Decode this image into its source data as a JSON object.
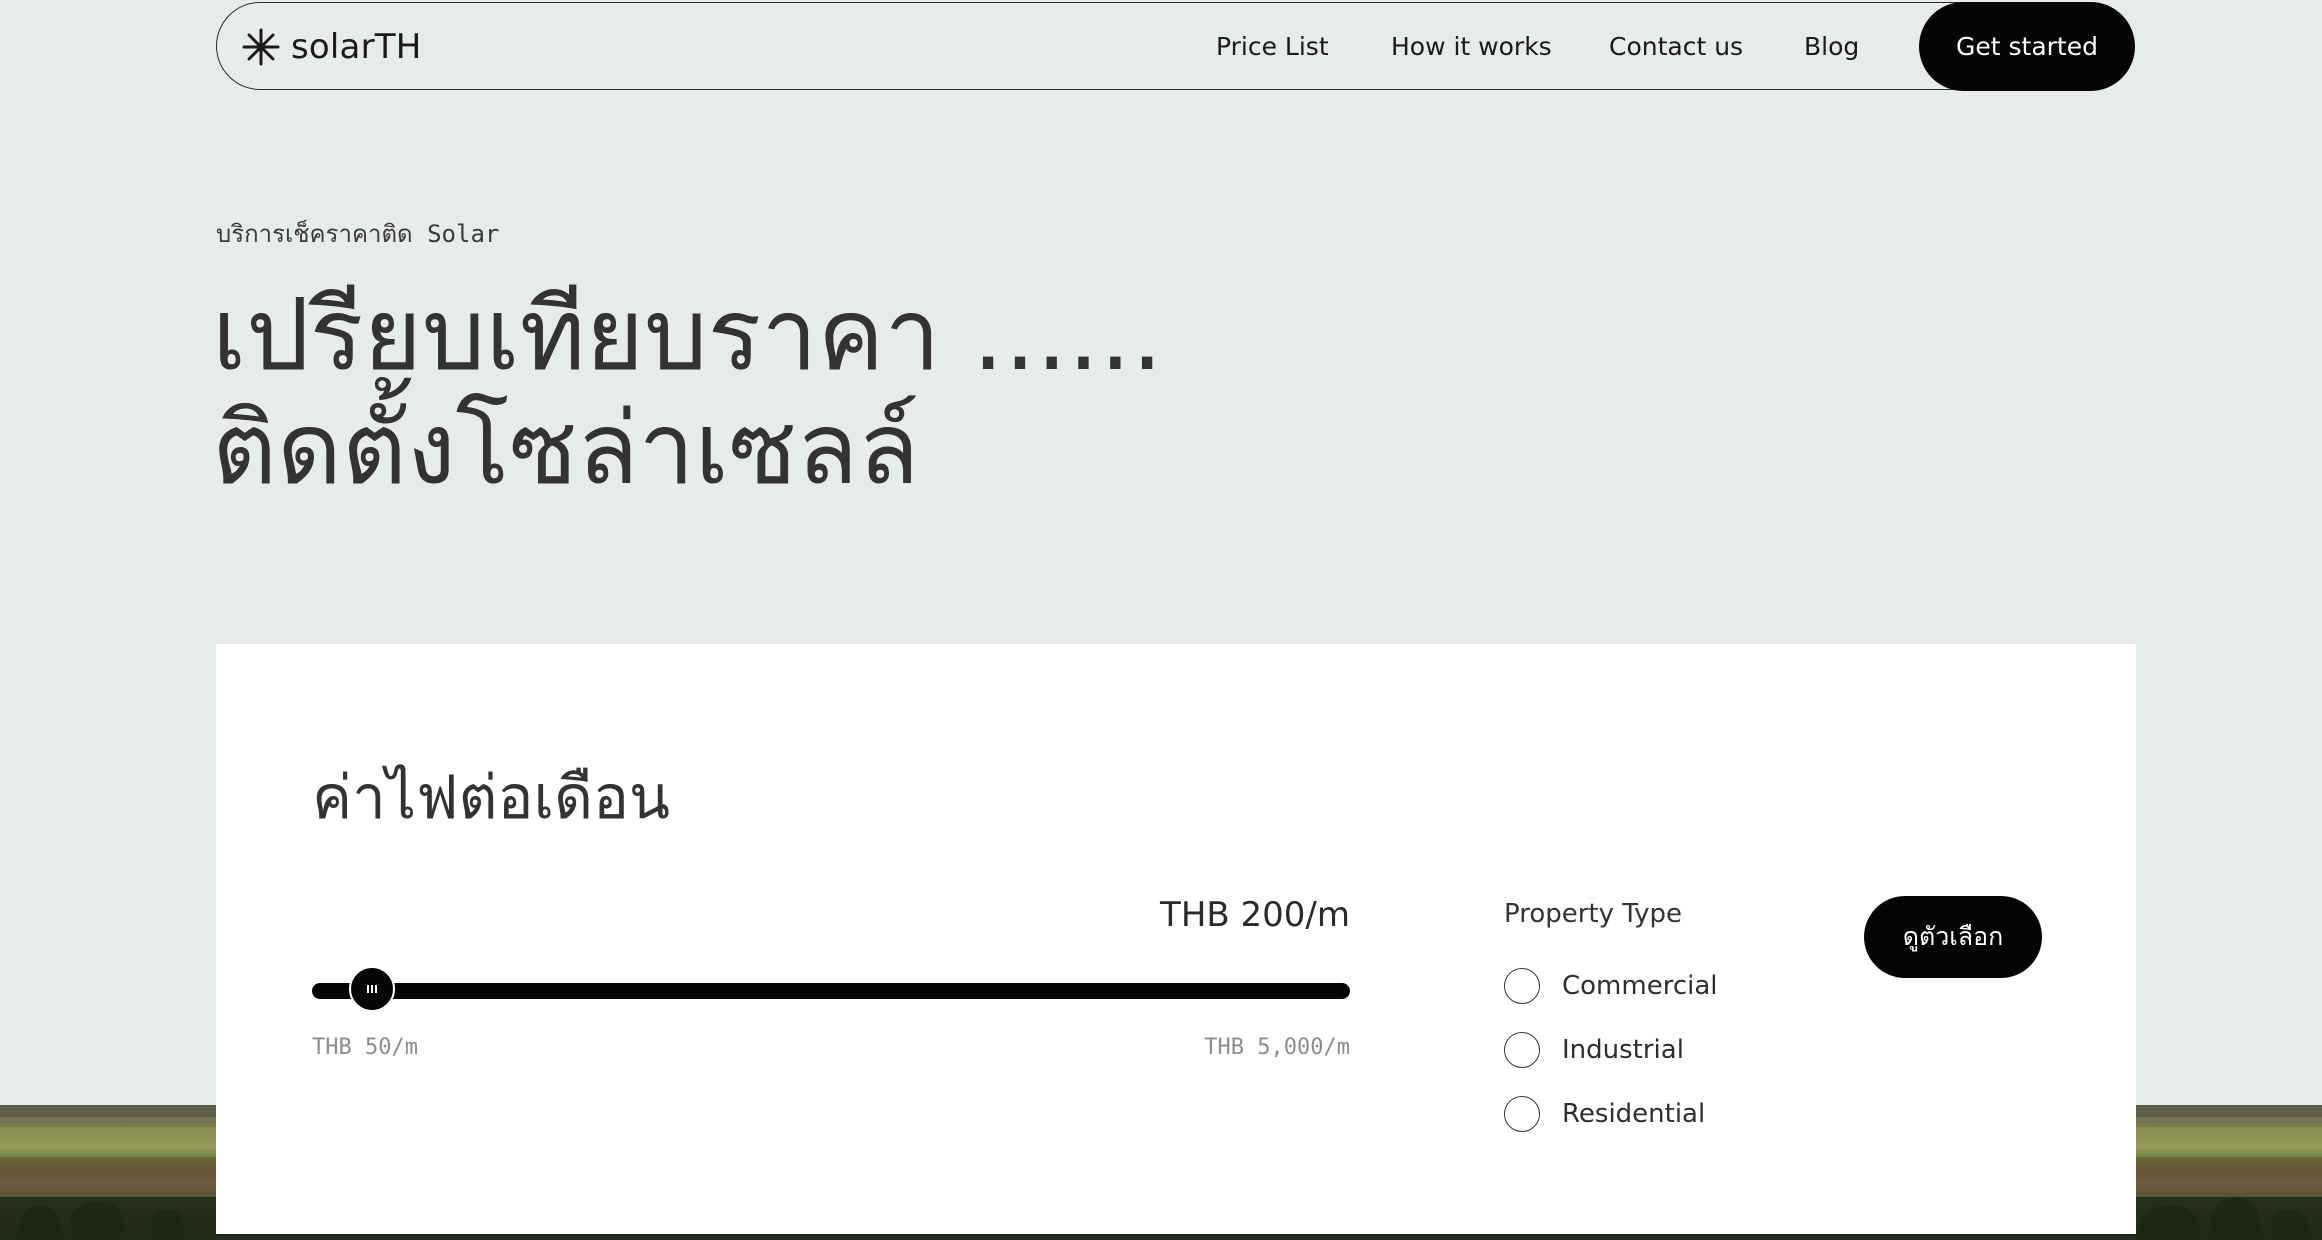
{
  "brand": {
    "name": "solarTH",
    "icon": "asterisk-icon"
  },
  "nav": {
    "links": [
      "Price List",
      "How it works",
      "Contact us",
      "Blog"
    ],
    "cta": "Get started"
  },
  "hero": {
    "eyebrow": "บริการเช็คราคาติด Solar",
    "headline_line1": "เปรียบเทียบราคา ......",
    "headline_line2": "ติดตั้งโซล่าเซลล์"
  },
  "calculator": {
    "title": "ค่าไฟต่อเดือน",
    "slider": {
      "current_label": "THB 200/m",
      "min_label": "THB 50/m",
      "max_label": "THB 5,000/m",
      "min": 50,
      "max": 5000,
      "value": 200
    },
    "property_type": {
      "label": "Property Type",
      "options": [
        "Commercial",
        "Industrial",
        "Residential"
      ]
    },
    "submit_label": "ดูตัวเลือก"
  },
  "colors": {
    "background": "#e8ece9",
    "primary": "#050505",
    "card": "#ffffff",
    "muted_text": "#8d8d8d"
  }
}
